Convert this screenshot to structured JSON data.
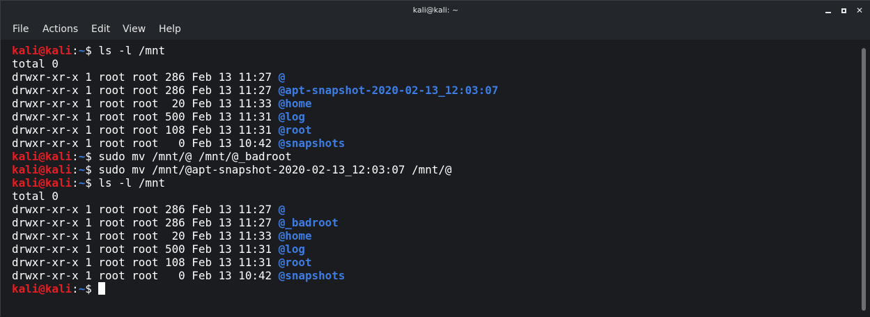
{
  "window": {
    "title": "kali@kali: ~",
    "minimize_glyph": "minimize-icon",
    "maximize_glyph": "maximize-icon",
    "close_glyph": "✕"
  },
  "menu": {
    "items": [
      "File",
      "Actions",
      "Edit",
      "View",
      "Help"
    ]
  },
  "colors": {
    "user": "#e51e24",
    "path": "#3d7de3",
    "directory": "#3d7de3",
    "text": "#ffffff",
    "background": "#1a1c20"
  },
  "terminal": {
    "prompt_user": "kali@kali",
    "prompt_path": "~",
    "prompt_symbol": "$",
    "lines": [
      {
        "type": "prompt",
        "command": "ls -l /mnt"
      },
      {
        "type": "output",
        "text": "total 0"
      },
      {
        "type": "listing",
        "meta": "drwxr-xr-x 1 root root 286 Feb 13 11:27",
        "name": "@"
      },
      {
        "type": "listing",
        "meta": "drwxr-xr-x 1 root root 286 Feb 13 11:27",
        "name": "@apt-snapshot-2020-02-13_12:03:07"
      },
      {
        "type": "listing",
        "meta": "drwxr-xr-x 1 root root  20 Feb 13 11:33",
        "name": "@home"
      },
      {
        "type": "listing",
        "meta": "drwxr-xr-x 1 root root 500 Feb 13 11:31",
        "name": "@log"
      },
      {
        "type": "listing",
        "meta": "drwxr-xr-x 1 root root 108 Feb 13 11:31",
        "name": "@root"
      },
      {
        "type": "listing",
        "meta": "drwxr-xr-x 1 root root   0 Feb 13 10:42",
        "name": "@snapshots"
      },
      {
        "type": "prompt",
        "command": "sudo mv /mnt/@ /mnt/@_badroot"
      },
      {
        "type": "prompt",
        "command": "sudo mv /mnt/@apt-snapshot-2020-02-13_12:03:07 /mnt/@"
      },
      {
        "type": "prompt",
        "command": "ls -l /mnt"
      },
      {
        "type": "output",
        "text": "total 0"
      },
      {
        "type": "listing",
        "meta": "drwxr-xr-x 1 root root 286 Feb 13 11:27",
        "name": "@"
      },
      {
        "type": "listing",
        "meta": "drwxr-xr-x 1 root root 286 Feb 13 11:27",
        "name": "@_badroot"
      },
      {
        "type": "listing",
        "meta": "drwxr-xr-x 1 root root  20 Feb 13 11:33",
        "name": "@home"
      },
      {
        "type": "listing",
        "meta": "drwxr-xr-x 1 root root 500 Feb 13 11:31",
        "name": "@log"
      },
      {
        "type": "listing",
        "meta": "drwxr-xr-x 1 root root 108 Feb 13 11:31",
        "name": "@root"
      },
      {
        "type": "listing",
        "meta": "drwxr-xr-x 1 root root   0 Feb 13 10:42",
        "name": "@snapshots"
      },
      {
        "type": "prompt",
        "command": "",
        "cursor": true
      }
    ]
  }
}
